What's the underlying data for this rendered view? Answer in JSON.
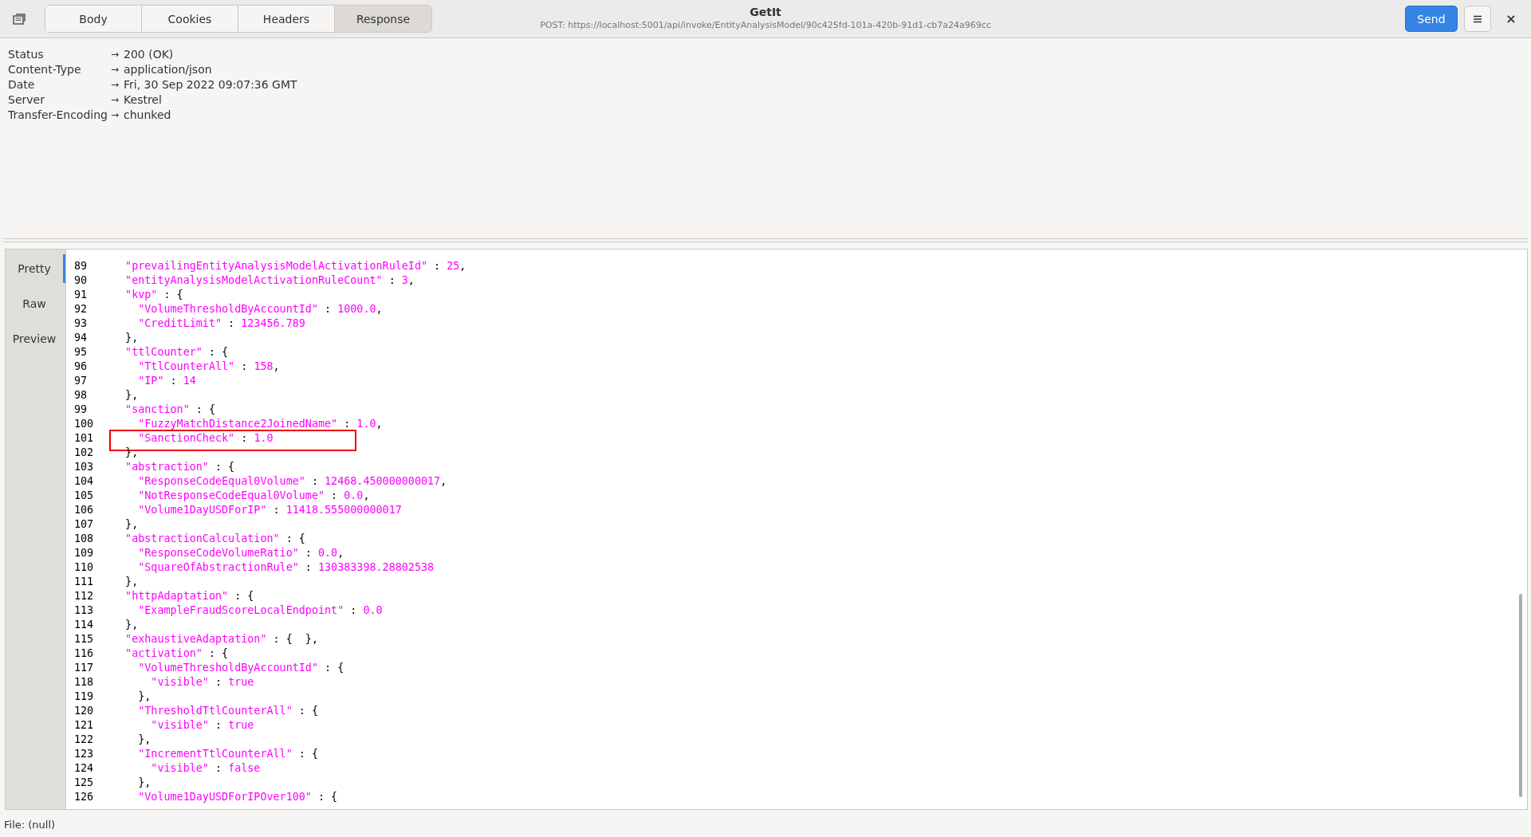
{
  "header": {
    "tabs": [
      {
        "label": "Body",
        "selected": false
      },
      {
        "label": "Cookies",
        "selected": false
      },
      {
        "label": "Headers",
        "selected": false
      },
      {
        "label": "Response",
        "selected": true
      }
    ],
    "title": "GetIt",
    "subtitle": "POST: https://localhost:5001/api/invoke/EntityAnalysisModel/90c425fd-101a-420b-91d1-cb7a24a969cc",
    "send_button": "Send",
    "close_button": "×"
  },
  "response_headers": [
    {
      "name": "Status",
      "arrow": "→",
      "value": "200 (OK)"
    },
    {
      "name": "Content-Type",
      "arrow": "→",
      "value": "application/json"
    },
    {
      "name": "Date",
      "arrow": "→",
      "value": "Fri, 30 Sep 2022 09:07:36 GMT"
    },
    {
      "name": "Server",
      "arrow": "→",
      "value": "Kestrel"
    },
    {
      "name": "Transfer-Encoding",
      "arrow": "→",
      "value": "chunked"
    }
  ],
  "view_tabs": [
    {
      "label": "Pretty",
      "selected": true
    },
    {
      "label": "Raw",
      "selected": false
    },
    {
      "label": "Preview",
      "selected": false
    }
  ],
  "code_lines": [
    {
      "number": "89",
      "boxed": false,
      "tokens": [
        {
          "kind": "string",
          "text": "  \"prevailingEntityAnalysisModelActivationRuleId\""
        },
        {
          "kind": "plain",
          "text": " : "
        },
        {
          "kind": "string",
          "text": "25"
        },
        {
          "kind": "plain",
          "text": ","
        }
      ]
    },
    {
      "number": "90",
      "boxed": false,
      "tokens": [
        {
          "kind": "string",
          "text": "  \"entityAnalysisModelActivationRuleCount\""
        },
        {
          "kind": "plain",
          "text": " : "
        },
        {
          "kind": "string",
          "text": "3"
        },
        {
          "kind": "plain",
          "text": ","
        }
      ]
    },
    {
      "number": "91",
      "boxed": false,
      "tokens": [
        {
          "kind": "string",
          "text": "  \"kvp\""
        },
        {
          "kind": "plain",
          "text": " : {"
        }
      ]
    },
    {
      "number": "92",
      "boxed": false,
      "tokens": [
        {
          "kind": "string",
          "text": "    \"VolumeThresholdByAccountId\""
        },
        {
          "kind": "plain",
          "text": " : "
        },
        {
          "kind": "string",
          "text": "1000.0"
        },
        {
          "kind": "plain",
          "text": ","
        }
      ]
    },
    {
      "number": "93",
      "boxed": false,
      "tokens": [
        {
          "kind": "string",
          "text": "    \"CreditLimit\""
        },
        {
          "kind": "plain",
          "text": " : "
        },
        {
          "kind": "string",
          "text": "123456.789"
        }
      ]
    },
    {
      "number": "94",
      "boxed": false,
      "tokens": [
        {
          "kind": "plain",
          "text": "  },"
        }
      ]
    },
    {
      "number": "95",
      "boxed": false,
      "tokens": [
        {
          "kind": "string",
          "text": "  \"ttlCounter\""
        },
        {
          "kind": "plain",
          "text": " : {"
        }
      ]
    },
    {
      "number": "96",
      "boxed": false,
      "tokens": [
        {
          "kind": "string",
          "text": "    \"TtlCounterAll\""
        },
        {
          "kind": "plain",
          "text": " : "
        },
        {
          "kind": "string",
          "text": "158"
        },
        {
          "kind": "plain",
          "text": ","
        }
      ]
    },
    {
      "number": "97",
      "boxed": false,
      "tokens": [
        {
          "kind": "string",
          "text": "    \"IP\""
        },
        {
          "kind": "plain",
          "text": " : "
        },
        {
          "kind": "string",
          "text": "14"
        }
      ]
    },
    {
      "number": "98",
      "boxed": false,
      "tokens": [
        {
          "kind": "plain",
          "text": "  },"
        }
      ]
    },
    {
      "number": "99",
      "boxed": false,
      "tokens": [
        {
          "kind": "string",
          "text": "  \"sanction\""
        },
        {
          "kind": "plain",
          "text": " : {"
        }
      ]
    },
    {
      "number": "100",
      "boxed": false,
      "tokens": [
        {
          "kind": "string",
          "text": "    \"FuzzyMatchDistance2JoinedName\""
        },
        {
          "kind": "plain",
          "text": " : "
        },
        {
          "kind": "string",
          "text": "1.0"
        },
        {
          "kind": "plain",
          "text": ","
        }
      ]
    },
    {
      "number": "101",
      "boxed": true,
      "tokens": [
        {
          "kind": "string",
          "text": "    \"SanctionCheck\""
        },
        {
          "kind": "plain",
          "text": " : "
        },
        {
          "kind": "string",
          "text": "1.0"
        }
      ]
    },
    {
      "number": "102",
      "boxed": false,
      "tokens": [
        {
          "kind": "plain",
          "text": "  },"
        }
      ]
    },
    {
      "number": "103",
      "boxed": false,
      "tokens": [
        {
          "kind": "string",
          "text": "  \"abstraction\""
        },
        {
          "kind": "plain",
          "text": " : {"
        }
      ]
    },
    {
      "number": "104",
      "boxed": false,
      "tokens": [
        {
          "kind": "string",
          "text": "    \"ResponseCodeEqual0Volume\""
        },
        {
          "kind": "plain",
          "text": " : "
        },
        {
          "kind": "string",
          "text": "12468.450000000017"
        },
        {
          "kind": "plain",
          "text": ","
        }
      ]
    },
    {
      "number": "105",
      "boxed": false,
      "tokens": [
        {
          "kind": "string",
          "text": "    \"NotResponseCodeEqual0Volume\""
        },
        {
          "kind": "plain",
          "text": " : "
        },
        {
          "kind": "string",
          "text": "0.0"
        },
        {
          "kind": "plain",
          "text": ","
        }
      ]
    },
    {
      "number": "106",
      "boxed": false,
      "tokens": [
        {
          "kind": "string",
          "text": "    \"Volume1DayUSDForIP\""
        },
        {
          "kind": "plain",
          "text": " : "
        },
        {
          "kind": "string",
          "text": "11418.555000000017"
        }
      ]
    },
    {
      "number": "107",
      "boxed": false,
      "tokens": [
        {
          "kind": "plain",
          "text": "  },"
        }
      ]
    },
    {
      "number": "108",
      "boxed": false,
      "tokens": [
        {
          "kind": "string",
          "text": "  \"abstractionCalculation\""
        },
        {
          "kind": "plain",
          "text": " : {"
        }
      ]
    },
    {
      "number": "109",
      "boxed": false,
      "tokens": [
        {
          "kind": "string",
          "text": "    \"ResponseCodeVolumeRatio\""
        },
        {
          "kind": "plain",
          "text": " : "
        },
        {
          "kind": "string",
          "text": "0.0"
        },
        {
          "kind": "plain",
          "text": ","
        }
      ]
    },
    {
      "number": "110",
      "boxed": false,
      "tokens": [
        {
          "kind": "string",
          "text": "    \"SquareOfAbstractionRule\""
        },
        {
          "kind": "plain",
          "text": " : "
        },
        {
          "kind": "string",
          "text": "130383398.28802538"
        }
      ]
    },
    {
      "number": "111",
      "boxed": false,
      "tokens": [
        {
          "kind": "plain",
          "text": "  },"
        }
      ]
    },
    {
      "number": "112",
      "boxed": false,
      "tokens": [
        {
          "kind": "string",
          "text": "  \"httpAdaptation\""
        },
        {
          "kind": "plain",
          "text": " : {"
        }
      ]
    },
    {
      "number": "113",
      "boxed": false,
      "tokens": [
        {
          "kind": "string",
          "text": "    \"ExampleFraudScoreLocalEndpoint\""
        },
        {
          "kind": "plain",
          "text": " : "
        },
        {
          "kind": "string",
          "text": "0.0"
        }
      ]
    },
    {
      "number": "114",
      "boxed": false,
      "tokens": [
        {
          "kind": "plain",
          "text": "  },"
        }
      ]
    },
    {
      "number": "115",
      "boxed": false,
      "tokens": [
        {
          "kind": "string",
          "text": "  \"exhaustiveAdaptation\""
        },
        {
          "kind": "plain",
          "text": " : {  },"
        }
      ]
    },
    {
      "number": "116",
      "boxed": false,
      "tokens": [
        {
          "kind": "string",
          "text": "  \"activation\""
        },
        {
          "kind": "plain",
          "text": " : {"
        }
      ]
    },
    {
      "number": "117",
      "boxed": false,
      "tokens": [
        {
          "kind": "string",
          "text": "    \"VolumeThresholdByAccountId\""
        },
        {
          "kind": "plain",
          "text": " : {"
        }
      ]
    },
    {
      "number": "118",
      "boxed": false,
      "tokens": [
        {
          "kind": "string",
          "text": "      \"visible\""
        },
        {
          "kind": "plain",
          "text": " : "
        },
        {
          "kind": "string",
          "text": "true"
        }
      ]
    },
    {
      "number": "119",
      "boxed": false,
      "tokens": [
        {
          "kind": "plain",
          "text": "    },"
        }
      ]
    },
    {
      "number": "120",
      "boxed": false,
      "tokens": [
        {
          "kind": "string",
          "text": "    \"ThresholdTtlCounterAll\""
        },
        {
          "kind": "plain",
          "text": " : {"
        }
      ]
    },
    {
      "number": "121",
      "boxed": false,
      "tokens": [
        {
          "kind": "string",
          "text": "      \"visible\""
        },
        {
          "kind": "plain",
          "text": " : "
        },
        {
          "kind": "string",
          "text": "true"
        }
      ]
    },
    {
      "number": "122",
      "boxed": false,
      "tokens": [
        {
          "kind": "plain",
          "text": "    },"
        }
      ]
    },
    {
      "number": "123",
      "boxed": false,
      "tokens": [
        {
          "kind": "string",
          "text": "    \"IncrementTtlCounterAll\""
        },
        {
          "kind": "plain",
          "text": " : {"
        }
      ]
    },
    {
      "number": "124",
      "boxed": false,
      "tokens": [
        {
          "kind": "string",
          "text": "      \"visible\""
        },
        {
          "kind": "plain",
          "text": " : "
        },
        {
          "kind": "string",
          "text": "false"
        }
      ]
    },
    {
      "number": "125",
      "boxed": false,
      "tokens": [
        {
          "kind": "plain",
          "text": "    },"
        }
      ]
    },
    {
      "number": "126",
      "boxed": false,
      "tokens": [
        {
          "kind": "string",
          "text": "    \"Volume1DayUSDForIPOver100\""
        },
        {
          "kind": "plain",
          "text": " : {"
        }
      ]
    }
  ],
  "status_bar": "File: (null)"
}
